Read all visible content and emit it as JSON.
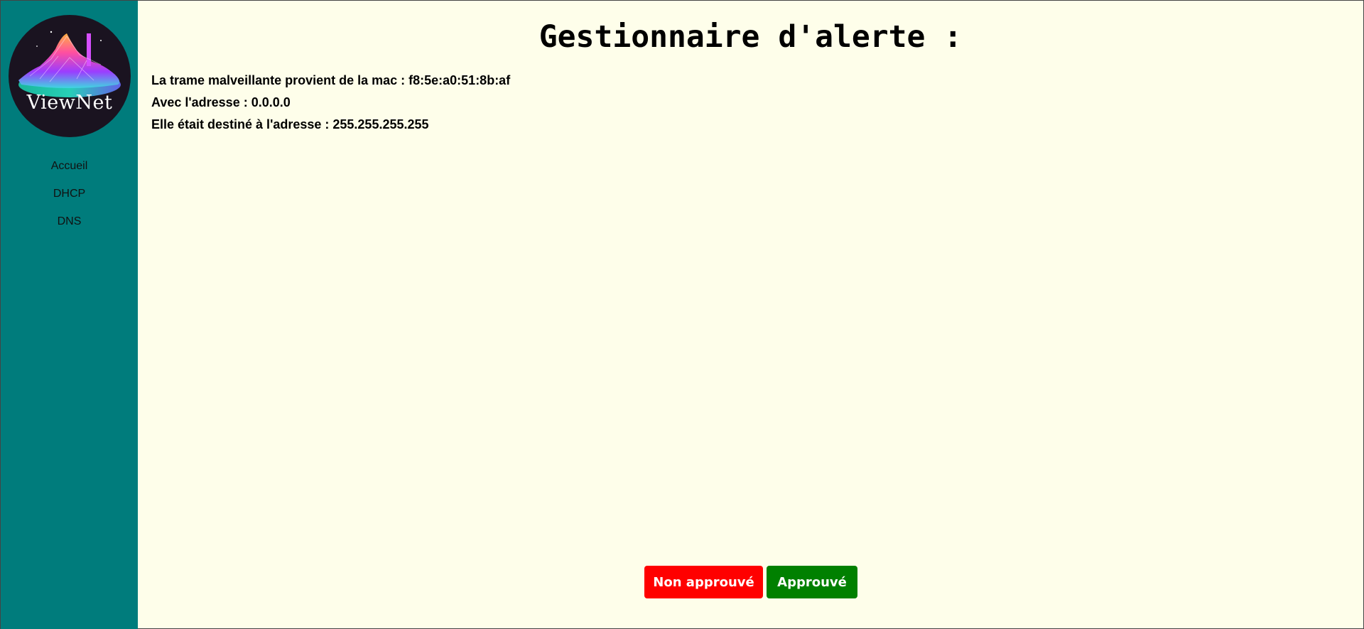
{
  "sidebar": {
    "logo_text": "ViewNet",
    "nav": [
      {
        "label": "Accueil"
      },
      {
        "label": "DHCP"
      },
      {
        "label": "DNS"
      }
    ]
  },
  "main": {
    "title": "Gestionnaire d'alerte :",
    "lines": [
      "La trame malveillante provient de la mac : f8:5e:a0:51:8b:af",
      "Avec l'adresse : 0.0.0.0",
      "Elle était destiné à l'adresse : 255.255.255.255"
    ],
    "buttons": {
      "reject_label": "Non approuvé",
      "approve_label": "Approuvé"
    }
  },
  "colors": {
    "sidebar_bg": "#007c7c",
    "page_bg": "#fefeea",
    "reject": "#ff0000",
    "approve": "#008000"
  }
}
